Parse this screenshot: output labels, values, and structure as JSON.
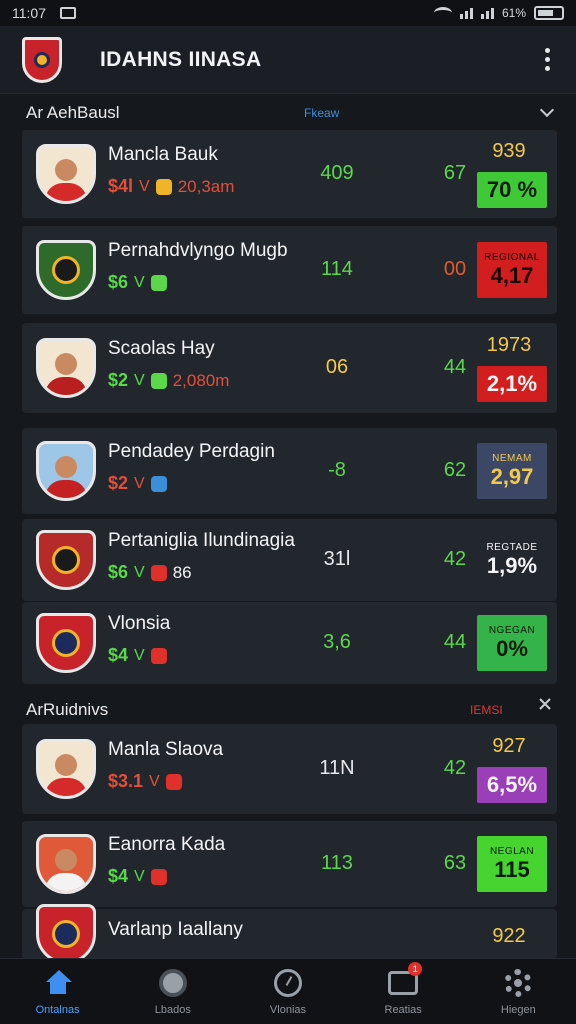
{
  "status_bar": {
    "time": "11:07",
    "battery": "61%"
  },
  "app": {
    "title": "IDAHNS IINASA"
  },
  "sections": [
    {
      "title": "Ar AehBausl",
      "subtitle": "Fkeaw",
      "subtitle_color": "#3b8fd9"
    },
    {
      "title": "ArRuidnivs",
      "subtitle": "IEMSI",
      "subtitle_color": "#e03a2f"
    }
  ],
  "players": [
    {
      "name": "Mancla Bauk",
      "price": "$4l",
      "vee": "V",
      "extra": "20,3am",
      "stat1": "409",
      "stat1_color": "#5bd84a",
      "stat2": "67",
      "top_label": "939",
      "pill_label": "",
      "pill_value": "70 %",
      "pill_color": "#3fc936",
      "pill_text_color": "#0d1a0a",
      "price_color": "#e34f3a",
      "vee_color": "#e34f3a",
      "extra_color": "#e34f3a",
      "icon_color": "#f0b428",
      "badge_body_color": "#d52a2a",
      "badge_bg": "#f3e6d0"
    },
    {
      "name": "Pernahdvlyngo Mugb",
      "price": "$6",
      "vee": "V",
      "extra": "",
      "stat1": "114",
      "stat1_color": "#5bd84a",
      "stat2": "00",
      "stat2_color": "#e35a2a",
      "top_label": "",
      "pill_label": "REGIONAL",
      "pill_value": "4,17",
      "pill_color": "#d21e1e",
      "pill_text_color": "#1a0303",
      "price_color": "#5bd84a",
      "vee_color": "#5bd84a",
      "extra_color": "#5bd84a",
      "icon_color": "#5bd84a",
      "badge_body_color": "#1a1a1a",
      "badge_bg": "#2e6a2a"
    },
    {
      "name": "Scaolas Hay",
      "price": "$2",
      "vee": "V",
      "extra": "2,080m",
      "stat1": "06",
      "stat1_color": "#f2c94c",
      "stat2": "44",
      "top_label": "1973",
      "pill_label": "",
      "pill_value": "2,1%",
      "pill_color": "#d21e1e",
      "pill_text_color": "#f6f6f6",
      "price_color": "#5bd84a",
      "vee_color": "#5bd84a",
      "extra_color": "#e34f3a",
      "icon_color": "#5bd84a",
      "badge_body_color": "#b8201f",
      "badge_bg": "#f3e6d0"
    },
    {
      "name": "Pendadey Perdagin",
      "price": "$2",
      "vee": "V",
      "extra": "",
      "stat1": "-8",
      "stat1_color": "#5bd84a",
      "stat2": "62",
      "top_label": "",
      "pill_label": "NEMAM",
      "pill_value": "2,97",
      "pill_color": "#3c4766",
      "pill_text_color": "#f2c94c",
      "price_color": "#e34f3a",
      "vee_color": "#e34f3a",
      "extra_color": "#5bd84a",
      "icon_color": "#3b8fd9",
      "badge_body_color": "#c42222",
      "badge_bg": "#9ec6e6"
    },
    {
      "name": "Pertaniglia Ilundinagia",
      "price": "$6",
      "vee": "V",
      "extra": "86",
      "stat1": "31l",
      "stat1_color": "#e6e8eb",
      "stat2": "42",
      "top_label": "",
      "pill_label": "REGTADE",
      "pill_value": "1,9%",
      "pill_color": "#22262d",
      "pill_text_color": "#f3f4f6",
      "price_color": "#5bd84a",
      "vee_color": "#5bd84a",
      "extra_color": "#f3f4f6",
      "icon_color": "#e0302c",
      "badge_body_color": "#1a1a1a",
      "badge_bg": "#b72a2a"
    },
    {
      "name": "Vlonsia",
      "price": "$4",
      "vee": "V",
      "extra": "",
      "stat1": "3,6",
      "stat1_color": "#5bd84a",
      "stat2": "44",
      "top_label": "",
      "pill_label": "NGEGAN",
      "pill_value": "0%",
      "pill_color": "#34b34a",
      "pill_text_color": "#0d1a0a",
      "price_color": "#5bd84a",
      "vee_color": "#5bd84a",
      "extra_color": "#f2c94c",
      "icon_color": "#e0302c",
      "badge_body_color": "#1d2b5c",
      "badge_bg": "#c8232b"
    },
    {
      "name": "Manla Slaova",
      "price": "$3.1",
      "vee": "V",
      "extra": "",
      "stat1": "11N",
      "stat1_color": "#e6e8eb",
      "stat2": "42",
      "top_label": "927",
      "pill_label": "",
      "pill_value": "6,5%",
      "pill_color": "#9a3fb8",
      "pill_text_color": "#f3f4f6",
      "price_color": "#e34f3a",
      "vee_color": "#e34f3a",
      "extra_color": "#5bd84a",
      "icon_color": "#e0302c",
      "badge_body_color": "#d52a2a",
      "badge_bg": "#f3e6d0"
    },
    {
      "name": "Eanorra Kada",
      "price": "$4",
      "vee": "V",
      "extra": "",
      "stat1": "113",
      "stat1_color": "#5bd84a",
      "stat2": "63",
      "top_label": "",
      "pill_label": "NEGLAN",
      "pill_value": "115",
      "pill_color": "#46d42f",
      "pill_text_color": "#0d1a0a",
      "price_color": "#5bd84a",
      "vee_color": "#5bd84a",
      "extra_color": "#e0302c",
      "icon_color": "#e0302c",
      "badge_body_color": "#f3f3f3",
      "badge_bg": "#e05a3a"
    },
    {
      "name": "Varlanp Iaallany",
      "price": "",
      "vee": "",
      "extra": "",
      "stat1": "",
      "stat1_color": "#5bd84a",
      "stat2": "",
      "top_label": "922",
      "pill_label": "",
      "pill_value": "",
      "pill_color": "transparent",
      "pill_text_color": "#f3f4f6",
      "price_color": "#5bd84a",
      "vee_color": "#5bd84a",
      "extra_color": "#5bd84a",
      "icon_color": "#5bd84a",
      "badge_body_color": "#1d2b5c",
      "badge_bg": "#c8232b"
    }
  ],
  "bottom_nav": [
    {
      "label": "Ontalnas",
      "icon": "home-icon",
      "active": true
    },
    {
      "label": "Lbados",
      "icon": "ball-icon",
      "active": false
    },
    {
      "label": "Vlonias",
      "icon": "clock-icon",
      "active": false
    },
    {
      "label": "Reatias",
      "icon": "stack-icon",
      "active": false,
      "badge": "1"
    },
    {
      "label": "Hiegen",
      "icon": "gear-icon",
      "active": false
    }
  ]
}
